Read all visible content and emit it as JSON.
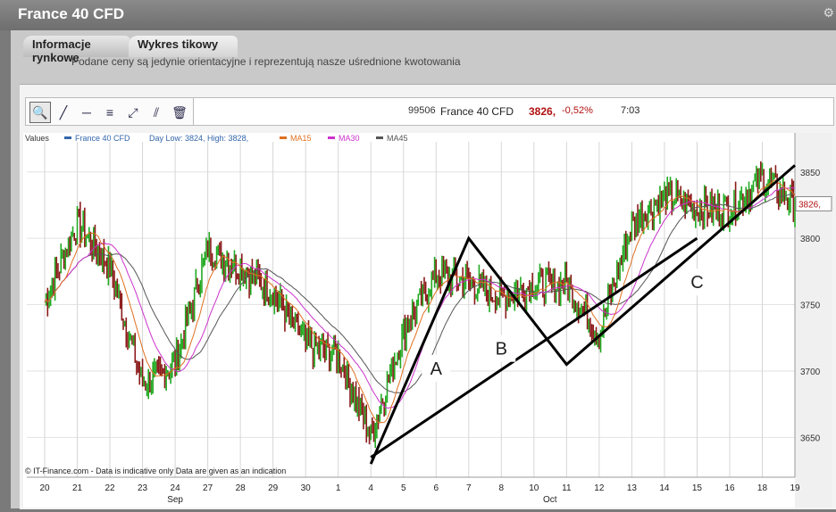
{
  "window": {
    "title": "France 40 CFD"
  },
  "tabs": [
    {
      "label": "Informacje rynkowe"
    },
    {
      "label": "Wykres tikowy"
    }
  ],
  "notice": "Podane ceny są jedynie orientacyjne i reprezentują nasze uśrednione kwotowania",
  "toolbar": {
    "tools": [
      "zoom-icon",
      "draw-line-icon",
      "horizontal-line-icon",
      "fibonacci-icon",
      "trend-channel-icon",
      "parallel-lines-icon",
      "trash-icon"
    ]
  },
  "info": {
    "id": "99506",
    "instrument": "France 40 CFD",
    "price": "3826,",
    "change": "-0,52%",
    "time": "7:03"
  },
  "legend": {
    "values": "Values",
    "series": "France 40 CFD",
    "daylow": "Day Low: 3824, High: 3828,",
    "ma15": "MA15",
    "ma30": "MA30",
    "ma45": "MA45"
  },
  "footer": "© IT-Finance.com - Data is indicative only Data are given as an indication",
  "colors": {
    "up": "#22aa22",
    "down": "#8b1a1a",
    "ma15": "#e07020",
    "ma30": "#cc33cc",
    "ma45": "#555555",
    "series": "#3366aa",
    "price": "#b01010"
  },
  "chart_data": {
    "type": "line",
    "title": "",
    "xlabel": "",
    "ylabel": "",
    "ylim": [
      3620,
      3870
    ],
    "y_ticks": [
      3650,
      3700,
      3750,
      3800,
      3850
    ],
    "current_price_label": "3826,",
    "x_tick_labels": [
      "20",
      "21",
      "22",
      "23",
      "24",
      "27",
      "28",
      "29",
      "30",
      "1",
      "4",
      "5",
      "6",
      "7",
      "8",
      "10",
      "11",
      "12",
      "13",
      "14",
      "15",
      "16",
      "18",
      "19"
    ],
    "month_labels": [
      "Sep",
      "Oct"
    ],
    "series": [
      {
        "name": "France 40 CFD",
        "x": [
          "20",
          "21",
          "22",
          "23",
          "24",
          "27",
          "28",
          "29",
          "30",
          "1",
          "4",
          "5",
          "6",
          "7",
          "8",
          "10",
          "11",
          "12",
          "13",
          "14",
          "15",
          "16",
          "18",
          "19"
        ],
        "values": [
          3752,
          3812,
          3778,
          3690,
          3705,
          3792,
          3778,
          3760,
          3720,
          3712,
          3650,
          3730,
          3772,
          3768,
          3755,
          3765,
          3765,
          3728,
          3810,
          3832,
          3822,
          3822,
          3845,
          3826
        ]
      }
    ],
    "annotations": [
      {
        "type": "polyline",
        "points": [
          [
            "4",
            3630
          ],
          [
            "7",
            3800
          ],
          [
            "11",
            3705
          ],
          [
            "19",
            3855
          ]
        ]
      },
      {
        "type": "line",
        "points": [
          [
            "4",
            3635
          ],
          [
            "15",
            3800
          ]
        ]
      },
      {
        "type": "text",
        "text": "A",
        "x": "6",
        "y": 3700
      },
      {
        "type": "text",
        "text": "B",
        "x": "8",
        "y": 3715
      },
      {
        "type": "text",
        "text": "C",
        "x": "15",
        "y": 3765
      }
    ]
  }
}
